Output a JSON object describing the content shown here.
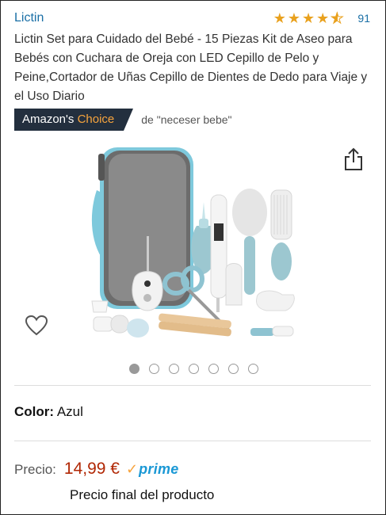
{
  "header": {
    "brand": "Lictin",
    "rating": {
      "stars": 4.5,
      "count": "91"
    }
  },
  "product": {
    "title": "Lictin Set para Cuidado del Bebé - 15 Piezas Kit de Aseo para Bebés con Cuchara de Oreja con LED Cepillo de Pelo y Peine,Cortador de Uñas Cepillo de Dientes de Dedo para Viaje y el Uso Diario",
    "image_dots": {
      "total": 7,
      "active_index": 0
    }
  },
  "badge": {
    "prefix": "Amazon's",
    "accent": "Choice",
    "for_text": "de \"neceser bebe\""
  },
  "icons": {
    "share": "share-icon",
    "favorite": "heart-icon"
  },
  "variant": {
    "label": "Color:",
    "value": "Azul"
  },
  "pricing": {
    "label": "Precio:",
    "price": "14,99 €",
    "prime_text": "prime",
    "note": "Precio final del producto"
  },
  "colors": {
    "link": "#1a6fa6",
    "star": "#e9a11e",
    "badge_bg": "#232f3e",
    "badge_accent": "#f7a43d",
    "price": "#b12704",
    "prime": "#1a98d5"
  }
}
